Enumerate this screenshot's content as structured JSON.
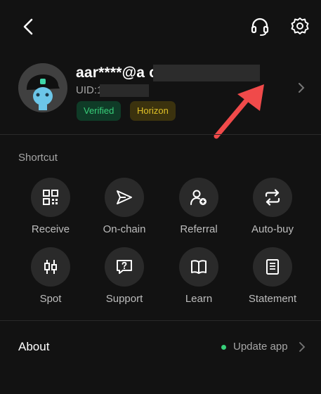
{
  "header": {
    "back_icon": "back-icon",
    "support_icon": "headset-icon",
    "settings_icon": "gear-icon"
  },
  "profile": {
    "email": "aar****@a                                com",
    "uid": "UID:1                99",
    "badges": [
      {
        "label": "Verified",
        "color": "#38d07a"
      },
      {
        "label": "Horizon",
        "color": "#e1c127"
      }
    ]
  },
  "shortcut": {
    "title": "Shortcut",
    "items": [
      {
        "label": "Receive",
        "icon": "qr-code-icon"
      },
      {
        "label": "On-chain",
        "icon": "send-icon"
      },
      {
        "label": "Referral",
        "icon": "add-user-icon"
      },
      {
        "label": "Auto-buy",
        "icon": "repeat-icon"
      },
      {
        "label": "Spot",
        "icon": "candlestick-icon"
      },
      {
        "label": "Support",
        "icon": "help-chat-icon"
      },
      {
        "label": "Learn",
        "icon": "book-icon"
      },
      {
        "label": "Statement",
        "icon": "document-icon"
      }
    ]
  },
  "about": {
    "label": "About",
    "update_label": "Update app"
  },
  "colors": {
    "background": "#121212",
    "circle": "#2a2a2a",
    "verified": "#38d07a",
    "horizon": "#e1c127",
    "arrow": "#f04a4a"
  }
}
